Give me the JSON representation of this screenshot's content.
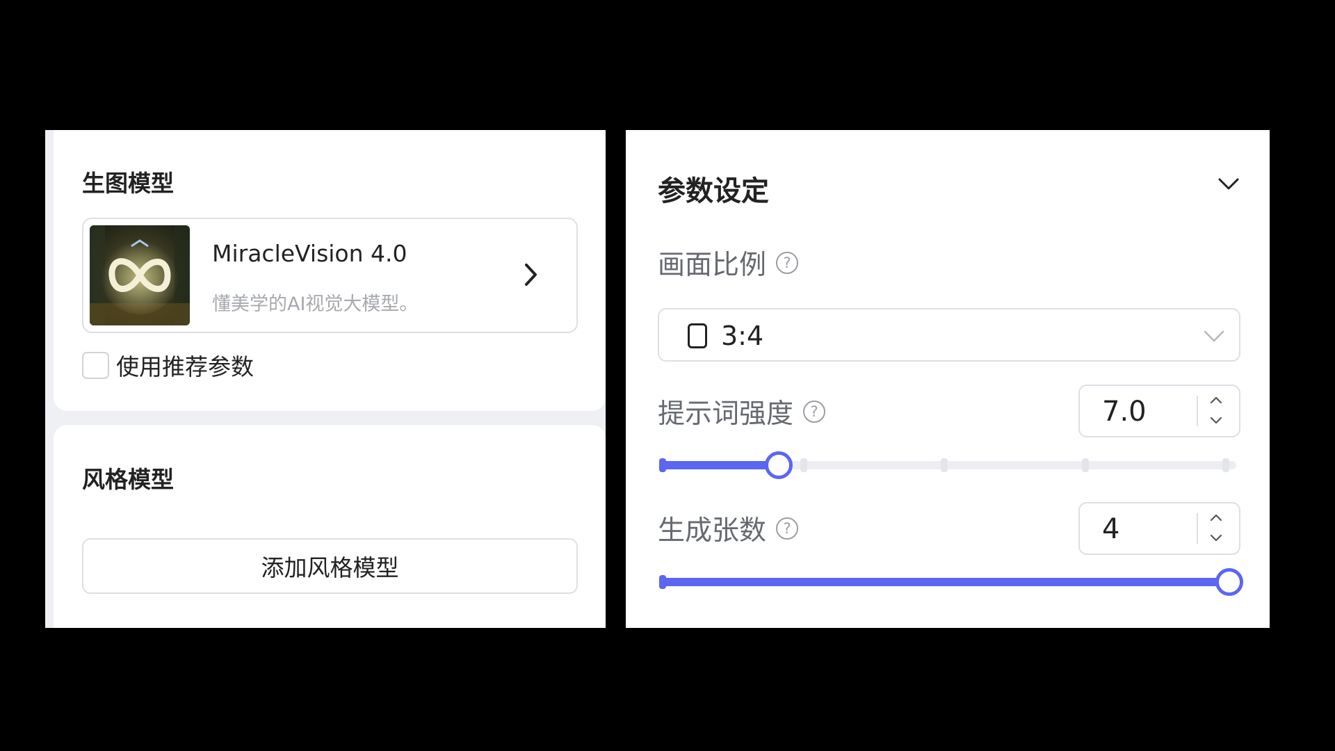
{
  "colors": {
    "accent": "#5b66f2",
    "border": "#dcdfe5",
    "text_primary": "#222222",
    "text_secondary": "#a6a9ae",
    "label_gray": "#666a70"
  },
  "model_section": {
    "title": "生图模型",
    "selected_model": {
      "name": "MiracleVision 4.0",
      "description": "懂美学的AI视觉大模型。",
      "thumbnail_icon": "miraclevision-infinity-logo"
    },
    "use_recommended_params": {
      "label": "使用推荐参数",
      "checked": false
    }
  },
  "style_section": {
    "title": "风格模型",
    "add_button_label": "添加风格模型"
  },
  "params_section": {
    "title": "参数设定",
    "collapse_icon": "chevron-down-icon",
    "aspect_ratio": {
      "label": "画面比例",
      "help_icon": "?",
      "value": "3:4",
      "shape_icon": "portrait-rectangle-icon"
    },
    "prompt_strength": {
      "label": "提示词强度",
      "help_icon": "?",
      "value": "7.0",
      "min": 0,
      "max": 20,
      "numeric": 4,
      "marks": [
        0,
        5,
        10,
        15,
        20
      ]
    },
    "image_count": {
      "label": "生成张数",
      "help_icon": "?",
      "value": "4",
      "min": 1,
      "max": 4,
      "numeric": 4,
      "marks": [
        1,
        4
      ]
    }
  }
}
